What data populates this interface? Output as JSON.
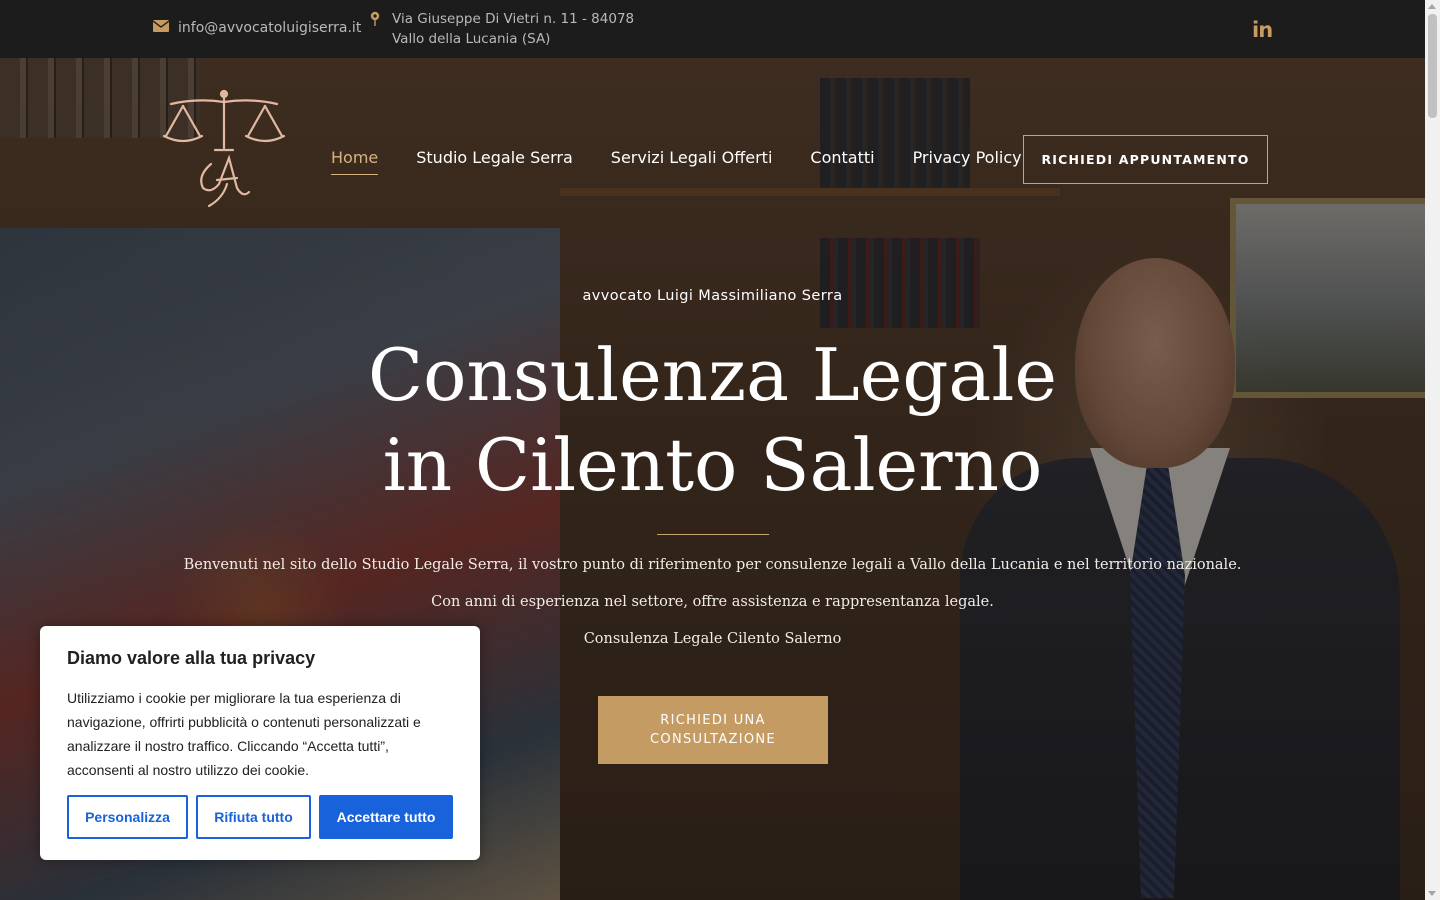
{
  "topbar": {
    "email": "info@avvocatoluigiserra.it",
    "address": "Via Giuseppe Di Vietri n. 11 - 84078 Vallo della Lucania (SA)",
    "social": "in"
  },
  "nav": {
    "items": [
      {
        "label": "Home",
        "active": true
      },
      {
        "label": "Studio Legale Serra",
        "active": false
      },
      {
        "label": "Servizi Legali Offerti",
        "active": false
      },
      {
        "label": "Contatti",
        "active": false
      },
      {
        "label": "Privacy Policy",
        "active": false
      }
    ],
    "cta": "RICHIEDI APPUNTAMENTO"
  },
  "hero": {
    "subtitle": "avvocato Luigi Massimiliano Serra",
    "title_line1": "Consulenza Legale",
    "title_line2": "in Cilento Salerno",
    "paragraphs": [
      "Benvenuti nel sito dello Studio Legale Serra, il vostro punto di riferimento per consulenze legali a Vallo della Lucania e nel territorio nazionale.",
      "Con anni di esperienza nel settore, offre assistenza e rappresentanza legale.",
      "Consulenza Legale Cilento Salerno"
    ],
    "cta": "RICHIEDI UNA CONSULTAZIONE"
  },
  "cookie": {
    "title": "Diamo valore alla tua privacy",
    "text": "Utilizziamo i cookie per migliorare la tua esperienza di navigazione, offrirti pubblicità o contenuti personalizzati e analizzare il nostro traffico. Cliccando “Accetta tutti”, acconsenti al nostro utilizzo dei cookie.",
    "customize": "Personalizza",
    "reject": "Rifiuta tutto",
    "accept": "Accettare tutto"
  },
  "colors": {
    "accent": "#c49b62",
    "cookie_blue": "#1863dc",
    "topbar": "#1c1c1c"
  },
  "icons": [
    "envelope-icon",
    "map-pin-icon",
    "linkedin-icon",
    "scales-logo"
  ]
}
